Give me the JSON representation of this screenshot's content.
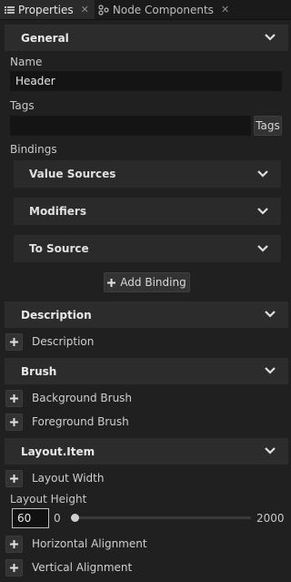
{
  "tabs": [
    {
      "label": "Properties",
      "icon": "list-icon",
      "active": true
    },
    {
      "label": "Node Components",
      "icon": "node-components-icon",
      "active": false
    }
  ],
  "sections": {
    "general": "General",
    "description": "Description",
    "brush": "Brush",
    "layout_item": "Layout.Item"
  },
  "general": {
    "name_label": "Name",
    "name_value": "Header",
    "tags_label": "Tags",
    "tags_value": "",
    "tags_button": "Tags",
    "bindings_label": "Bindings",
    "binding_groups": [
      "Value Sources",
      "Modifiers",
      "To Source"
    ],
    "add_binding": "Add Binding"
  },
  "description": {
    "add_label": "Description"
  },
  "brush": {
    "items": [
      "Background Brush",
      "Foreground Brush"
    ]
  },
  "layout": {
    "layout_width": "Layout Width",
    "layout_height_label": "Layout Height",
    "layout_height_value": "60",
    "slider_min": "0",
    "slider_max": "2000",
    "slider_value": 0,
    "horizontal_alignment": "Horizontal Alignment",
    "vertical_alignment": "Vertical Alignment"
  }
}
